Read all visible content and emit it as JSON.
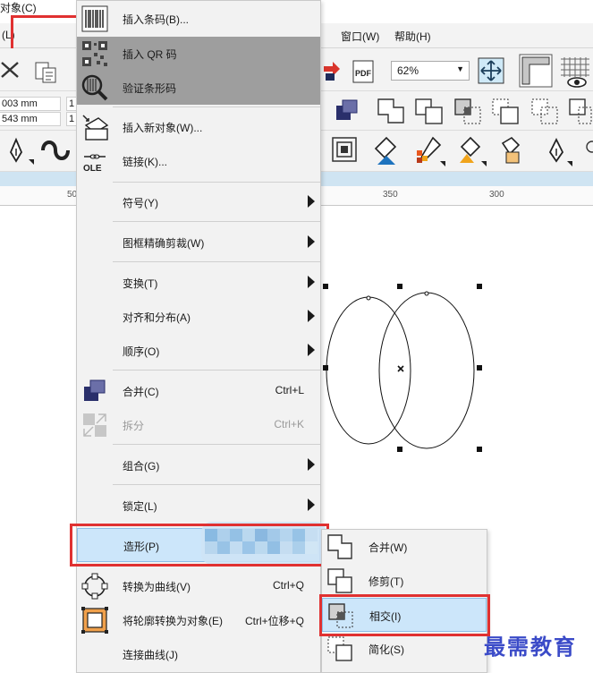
{
  "menubar": {
    "left_fragment": "(L)",
    "object_menu": "对象(C)",
    "window_menu": "窗口(W)",
    "help_menu": "帮助(H)"
  },
  "toolbar": {
    "zoom_value": "62%",
    "coord_x": "003 mm",
    "coord_y": "543 mm",
    "coord_x2": "1",
    "coord_y2": "1"
  },
  "ruler": {
    "ticks": [
      "50",
      "350",
      "300"
    ]
  },
  "object_menu": {
    "items": [
      {
        "label": "插入条码(B)...",
        "icon": "barcode-icon"
      },
      {
        "label": "插入 QR 码",
        "icon": "qr-code-icon"
      },
      {
        "label": "验证条形码",
        "icon": "magnifier-barcode-icon"
      },
      {
        "label": "插入新对象(W)...",
        "icon": "insert-object-icon"
      },
      {
        "label": "链接(K)...",
        "icon": "ole-link-icon",
        "icon_text": "OLE"
      },
      {
        "label": "符号(Y)"
      },
      {
        "label": "图框精确剪裁(W)"
      },
      {
        "label": "变换(T)"
      },
      {
        "label": "对齐和分布(A)"
      },
      {
        "label": "顺序(O)"
      },
      {
        "label": "合并(C)",
        "shortcut": "Ctrl+L",
        "icon": "combine-icon"
      },
      {
        "label": "拆分",
        "shortcut": "Ctrl+K",
        "icon": "break-apart-icon"
      },
      {
        "label": "组合(G)"
      },
      {
        "label": "锁定(L)"
      },
      {
        "label": "造形(P)"
      },
      {
        "label": "转换为曲线(V)",
        "shortcut": "Ctrl+Q",
        "icon": "convert-to-curves-icon"
      },
      {
        "label": "将轮廓转换为对象(E)",
        "shortcut": "Ctrl+位移+Q",
        "icon": "outline-to-object-icon"
      },
      {
        "label": "连接曲线(J)"
      }
    ]
  },
  "shaping_submenu": {
    "items": [
      {
        "label": "合并(W)",
        "icon": "weld-icon"
      },
      {
        "label": "修剪(T)",
        "icon": "trim-icon"
      },
      {
        "label": "相交(I)",
        "icon": "intersect-icon"
      },
      {
        "label": "简化(S)",
        "icon": "simplify-icon"
      }
    ]
  },
  "watermark": "最需教育",
  "colors": {
    "highlight_red": "#e03131",
    "menu_selected": "#cce6fa",
    "menu_hover_gray": "#9e9e9e",
    "icon_navy": "#2a2f6b"
  }
}
